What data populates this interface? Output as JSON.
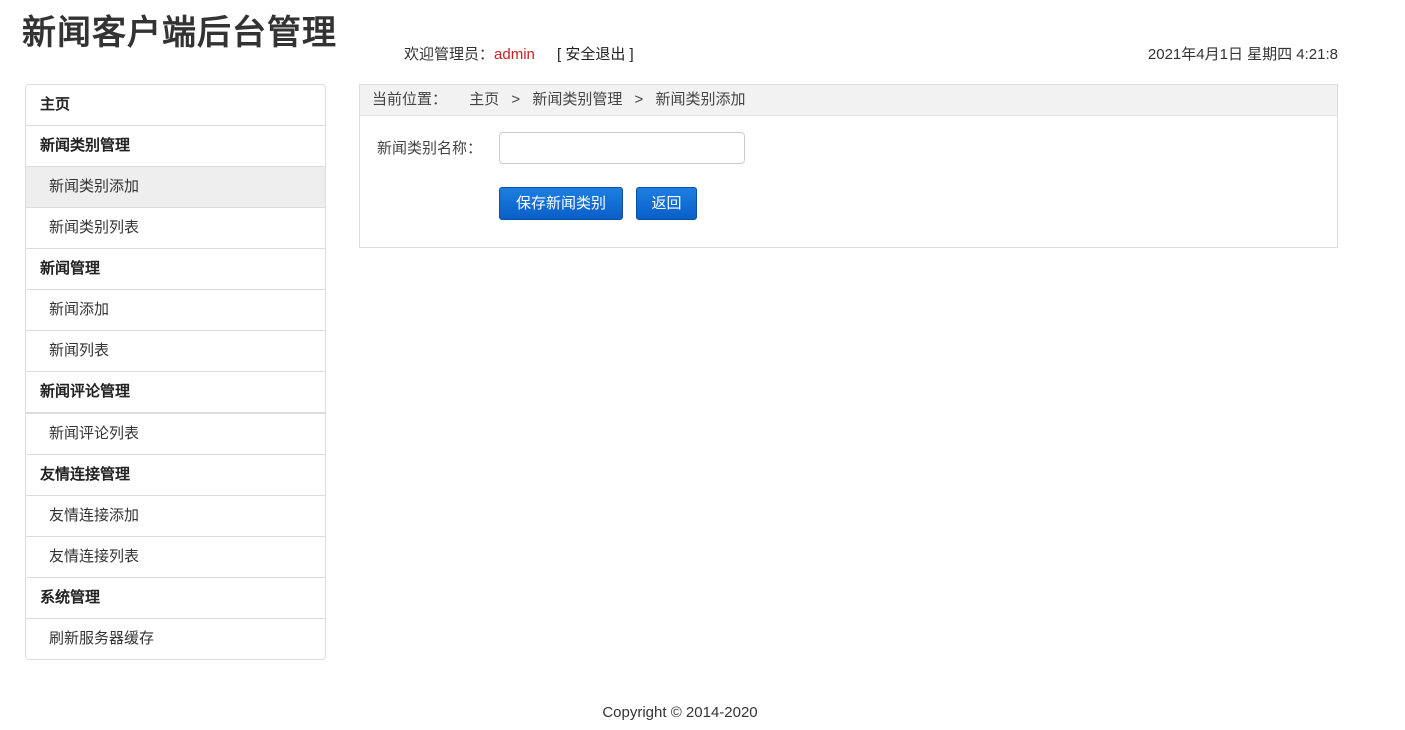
{
  "header": {
    "title": "新闻客户端后台管理",
    "welcome_prefix": "欢迎管理员：",
    "username": "admin",
    "logout": "[ 安全退出 ]",
    "datetime": "2021年4月1日 星期四 4:21:8"
  },
  "sidebar": {
    "items": [
      {
        "label": "主页",
        "type": "group"
      },
      {
        "label": "新闻类别管理",
        "type": "group"
      },
      {
        "label": "新闻类别添加",
        "type": "sub",
        "active": true
      },
      {
        "label": "新闻类别列表",
        "type": "sub"
      },
      {
        "label": "新闻管理",
        "type": "group"
      },
      {
        "label": "新闻添加",
        "type": "sub"
      },
      {
        "label": "新闻列表",
        "type": "sub"
      },
      {
        "label": "新闻评论管理",
        "type": "group"
      },
      {
        "label": "新闻评论列表",
        "type": "sub"
      },
      {
        "label": "友情连接管理",
        "type": "group"
      },
      {
        "label": "友情连接添加",
        "type": "sub"
      },
      {
        "label": "友情连接列表",
        "type": "sub"
      },
      {
        "label": "系统管理",
        "type": "group"
      },
      {
        "label": "刷新服务器缓存",
        "type": "sub"
      }
    ]
  },
  "breadcrumb": {
    "label": "当前位置：",
    "items": [
      "主页",
      "新闻类别管理",
      "新闻类别添加"
    ],
    "separator": ">"
  },
  "form": {
    "name_label": "新闻类别名称：",
    "name_value": "",
    "save_label": "保存新闻类别",
    "back_label": "返回"
  },
  "footer": {
    "copyright": "Copyright © 2014-2020"
  },
  "colors": {
    "accent": "#0a5ec8",
    "username": "#c91f1f",
    "active_bg": "#eeeeee"
  }
}
